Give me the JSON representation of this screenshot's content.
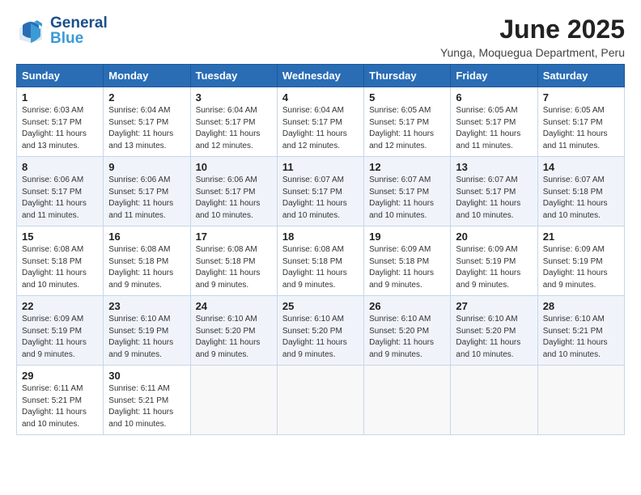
{
  "header": {
    "logo_line1": "General",
    "logo_line2": "Blue",
    "month_title": "June 2025",
    "subtitle": "Yunga, Moquegua Department, Peru"
  },
  "weekdays": [
    "Sunday",
    "Monday",
    "Tuesday",
    "Wednesday",
    "Thursday",
    "Friday",
    "Saturday"
  ],
  "weeks": [
    [
      {
        "day": "1",
        "info": "Sunrise: 6:03 AM\nSunset: 5:17 PM\nDaylight: 11 hours\nand 13 minutes."
      },
      {
        "day": "2",
        "info": "Sunrise: 6:04 AM\nSunset: 5:17 PM\nDaylight: 11 hours\nand 13 minutes."
      },
      {
        "day": "3",
        "info": "Sunrise: 6:04 AM\nSunset: 5:17 PM\nDaylight: 11 hours\nand 12 minutes."
      },
      {
        "day": "4",
        "info": "Sunrise: 6:04 AM\nSunset: 5:17 PM\nDaylight: 11 hours\nand 12 minutes."
      },
      {
        "day": "5",
        "info": "Sunrise: 6:05 AM\nSunset: 5:17 PM\nDaylight: 11 hours\nand 12 minutes."
      },
      {
        "day": "6",
        "info": "Sunrise: 6:05 AM\nSunset: 5:17 PM\nDaylight: 11 hours\nand 11 minutes."
      },
      {
        "day": "7",
        "info": "Sunrise: 6:05 AM\nSunset: 5:17 PM\nDaylight: 11 hours\nand 11 minutes."
      }
    ],
    [
      {
        "day": "8",
        "info": "Sunrise: 6:06 AM\nSunset: 5:17 PM\nDaylight: 11 hours\nand 11 minutes."
      },
      {
        "day": "9",
        "info": "Sunrise: 6:06 AM\nSunset: 5:17 PM\nDaylight: 11 hours\nand 11 minutes."
      },
      {
        "day": "10",
        "info": "Sunrise: 6:06 AM\nSunset: 5:17 PM\nDaylight: 11 hours\nand 10 minutes."
      },
      {
        "day": "11",
        "info": "Sunrise: 6:07 AM\nSunset: 5:17 PM\nDaylight: 11 hours\nand 10 minutes."
      },
      {
        "day": "12",
        "info": "Sunrise: 6:07 AM\nSunset: 5:17 PM\nDaylight: 11 hours\nand 10 minutes."
      },
      {
        "day": "13",
        "info": "Sunrise: 6:07 AM\nSunset: 5:17 PM\nDaylight: 11 hours\nand 10 minutes."
      },
      {
        "day": "14",
        "info": "Sunrise: 6:07 AM\nSunset: 5:18 PM\nDaylight: 11 hours\nand 10 minutes."
      }
    ],
    [
      {
        "day": "15",
        "info": "Sunrise: 6:08 AM\nSunset: 5:18 PM\nDaylight: 11 hours\nand 10 minutes."
      },
      {
        "day": "16",
        "info": "Sunrise: 6:08 AM\nSunset: 5:18 PM\nDaylight: 11 hours\nand 9 minutes."
      },
      {
        "day": "17",
        "info": "Sunrise: 6:08 AM\nSunset: 5:18 PM\nDaylight: 11 hours\nand 9 minutes."
      },
      {
        "day": "18",
        "info": "Sunrise: 6:08 AM\nSunset: 5:18 PM\nDaylight: 11 hours\nand 9 minutes."
      },
      {
        "day": "19",
        "info": "Sunrise: 6:09 AM\nSunset: 5:18 PM\nDaylight: 11 hours\nand 9 minutes."
      },
      {
        "day": "20",
        "info": "Sunrise: 6:09 AM\nSunset: 5:19 PM\nDaylight: 11 hours\nand 9 minutes."
      },
      {
        "day": "21",
        "info": "Sunrise: 6:09 AM\nSunset: 5:19 PM\nDaylight: 11 hours\nand 9 minutes."
      }
    ],
    [
      {
        "day": "22",
        "info": "Sunrise: 6:09 AM\nSunset: 5:19 PM\nDaylight: 11 hours\nand 9 minutes."
      },
      {
        "day": "23",
        "info": "Sunrise: 6:10 AM\nSunset: 5:19 PM\nDaylight: 11 hours\nand 9 minutes."
      },
      {
        "day": "24",
        "info": "Sunrise: 6:10 AM\nSunset: 5:20 PM\nDaylight: 11 hours\nand 9 minutes."
      },
      {
        "day": "25",
        "info": "Sunrise: 6:10 AM\nSunset: 5:20 PM\nDaylight: 11 hours\nand 9 minutes."
      },
      {
        "day": "26",
        "info": "Sunrise: 6:10 AM\nSunset: 5:20 PM\nDaylight: 11 hours\nand 9 minutes."
      },
      {
        "day": "27",
        "info": "Sunrise: 6:10 AM\nSunset: 5:20 PM\nDaylight: 11 hours\nand 10 minutes."
      },
      {
        "day": "28",
        "info": "Sunrise: 6:10 AM\nSunset: 5:21 PM\nDaylight: 11 hours\nand 10 minutes."
      }
    ],
    [
      {
        "day": "29",
        "info": "Sunrise: 6:11 AM\nSunset: 5:21 PM\nDaylight: 11 hours\nand 10 minutes."
      },
      {
        "day": "30",
        "info": "Sunrise: 6:11 AM\nSunset: 5:21 PM\nDaylight: 11 hours\nand 10 minutes."
      },
      {
        "day": "",
        "info": ""
      },
      {
        "day": "",
        "info": ""
      },
      {
        "day": "",
        "info": ""
      },
      {
        "day": "",
        "info": ""
      },
      {
        "day": "",
        "info": ""
      }
    ]
  ]
}
